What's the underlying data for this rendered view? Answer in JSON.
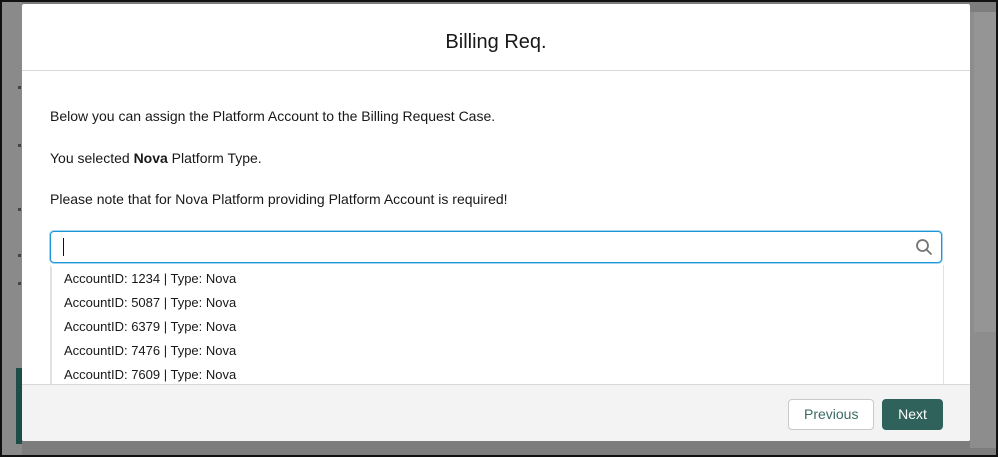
{
  "modal": {
    "title": "Billing Req.",
    "line1": "Below you can assign the Platform Account to the Billing Request Case.",
    "line2_prefix": "You selected ",
    "line2_bold": "Nova",
    "line2_suffix": " Platform Type.",
    "line3": "Please note that for Nova Platform providing Platform Account is required!"
  },
  "search": {
    "value": "",
    "icon": "search-icon"
  },
  "results": [
    "AccountID: 1234 | Type: Nova",
    "AccountID: 5087 | Type: Nova",
    "AccountID: 6379 | Type: Nova",
    "AccountID: 7476 | Type: Nova",
    "AccountID: 7609 | Type: Nova"
  ],
  "footer": {
    "previous_label": "Previous",
    "next_label": "Next"
  },
  "colors": {
    "brand_button": "#2e625a",
    "focus_border": "#1b96d6"
  }
}
